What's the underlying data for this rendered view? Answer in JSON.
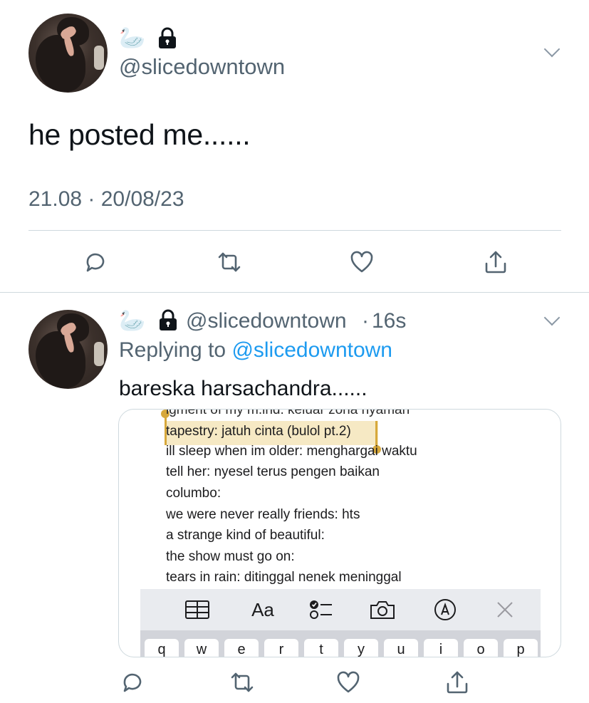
{
  "main_tweet": {
    "avatar": "profile-photo",
    "name_emoji": "🦢",
    "lock_icon": "lock-icon",
    "handle": "@slicedowntown",
    "text": "he posted me......",
    "timestamp": "21.08 · 20/08/23"
  },
  "reply_tweet": {
    "avatar": "profile-photo",
    "name_emoji": "🦢",
    "lock_icon": "lock-icon",
    "handle": "@slicedowntown",
    "time_sep": "·",
    "time": "16s",
    "replying_prefix": "Replying to",
    "replying_handle": "@slicedowntown",
    "text": "bareska harsachandra......",
    "image": {
      "lines": [
        "igment of my m.ind: keluar zona nyaman",
        "tapestry: jatuh cinta (bulol pt.2)",
        "ill sleep when im older: menghargai waktu",
        "tell her: nyesel terus pengen baikan",
        "columbo:",
        "we were never really friends: hts",
        "a strange kind of beautiful:",
        "the show must go on:",
        "tears in rain: ditinggal nenek meninggal"
      ],
      "toolbar_icons": [
        "table-icon",
        "format-icon",
        "checklist-icon",
        "camera-icon",
        "markup-icon",
        "close-icon"
      ],
      "toolbar_text_label": "Aa",
      "keys": [
        "q",
        "w",
        "e",
        "r",
        "t",
        "y",
        "u",
        "i",
        "o",
        "p"
      ]
    }
  },
  "actions": [
    "reply-icon",
    "retweet-icon",
    "like-icon",
    "share-icon"
  ],
  "colors": {
    "link": "#1d9bf0",
    "secondary_text": "#536471",
    "highlight": "#f6e9c4",
    "selection": "#d7a83b"
  }
}
